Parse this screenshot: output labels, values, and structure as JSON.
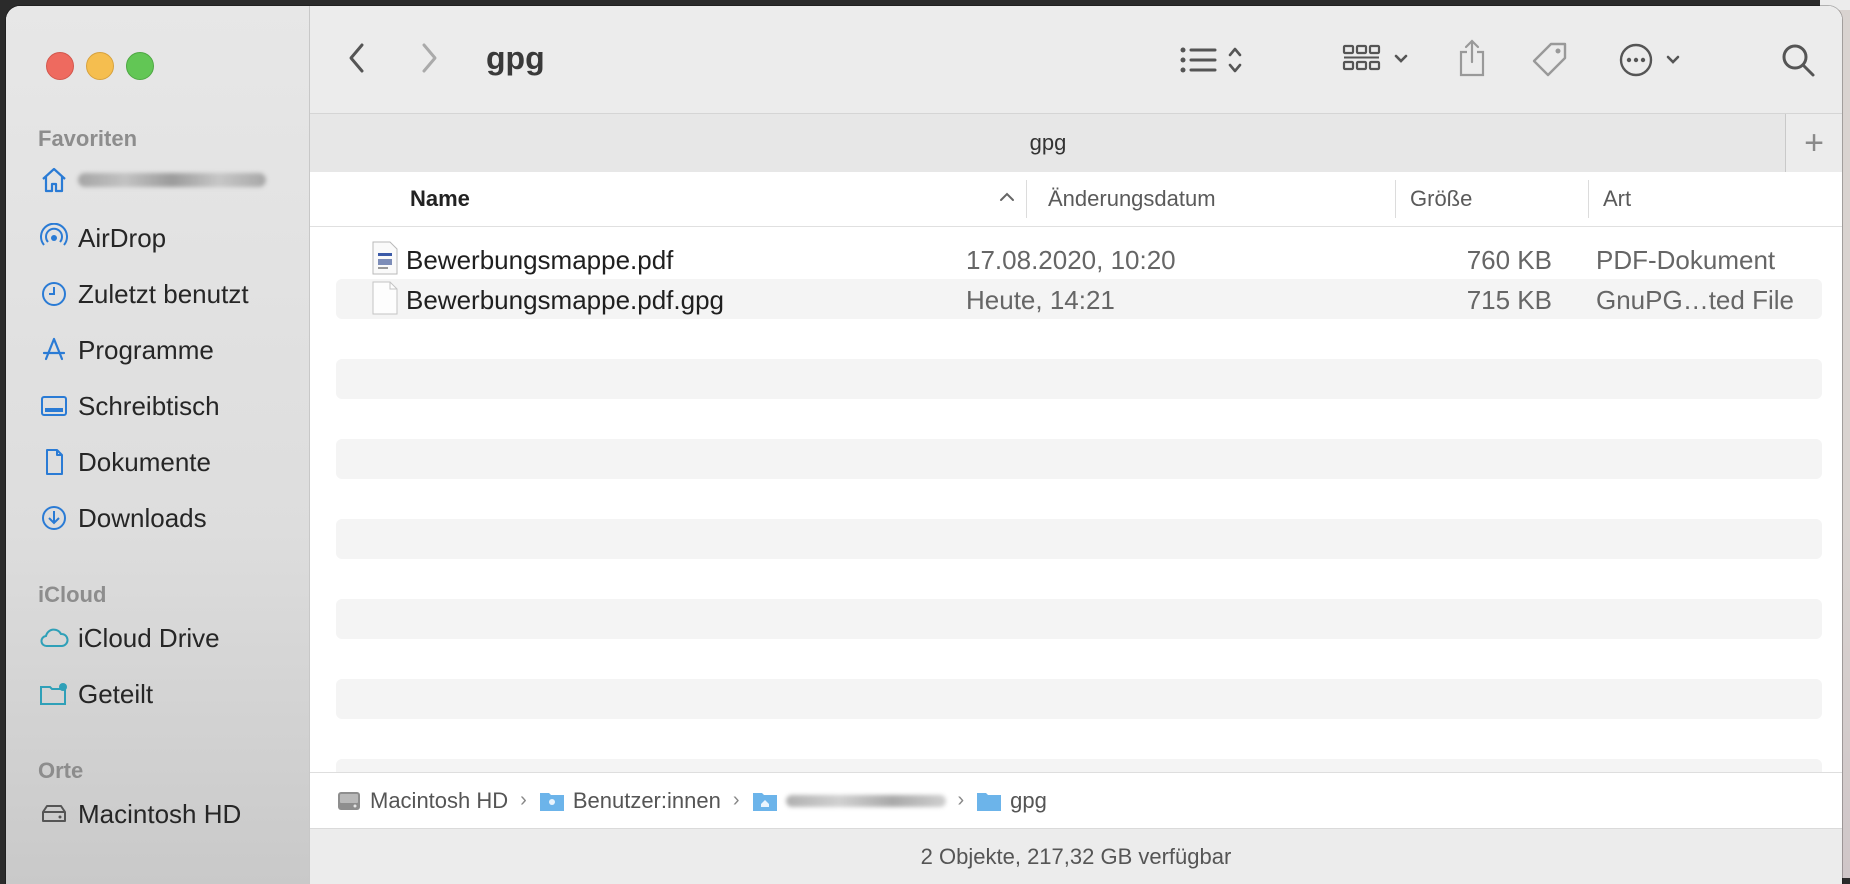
{
  "window": {
    "title": "gpg",
    "tab_title": "gpg",
    "tab_add": "+"
  },
  "sidebar": {
    "sections": [
      {
        "heading": "Favoriten"
      },
      {
        "heading": "iCloud"
      },
      {
        "heading": "Orte"
      }
    ],
    "items": [
      {
        "label": "",
        "icon": "home-icon",
        "redacted": true
      },
      {
        "label": "AirDrop",
        "icon": "airdrop-icon"
      },
      {
        "label": "Zuletzt benutzt",
        "icon": "clock-icon"
      },
      {
        "label": "Programme",
        "icon": "apps-icon"
      },
      {
        "label": "Schreibtisch",
        "icon": "desktop-icon"
      },
      {
        "label": "Dokumente",
        "icon": "document-icon"
      },
      {
        "label": "Downloads",
        "icon": "download-icon"
      },
      {
        "label": "iCloud Drive",
        "icon": "cloud-icon"
      },
      {
        "label": "Geteilt",
        "icon": "shared-folder-icon"
      },
      {
        "label": "Macintosh HD",
        "icon": "disk-icon"
      }
    ],
    "accent": "#2a7bd5"
  },
  "columns": {
    "name": "Name",
    "date": "Änderungsdatum",
    "size": "Größe",
    "kind": "Art"
  },
  "files": [
    {
      "name": "Bewerbungsmappe.pdf",
      "date": "17.08.2020, 10:20",
      "size": "760 KB",
      "kind": "PDF-Dokument",
      "icon": "pdf-file-icon"
    },
    {
      "name": "Bewerbungsmappe.pdf.gpg",
      "date": "Heute, 14:21",
      "size": "715 KB",
      "kind": "GnuPG…ted File",
      "icon": "blank-file-icon"
    }
  ],
  "path": {
    "items": [
      {
        "label": "Macintosh HD",
        "icon": "disk-icon"
      },
      {
        "label": "Benutzer:innen",
        "icon": "users-folder-icon"
      },
      {
        "label": "",
        "icon": "home-folder-icon",
        "redacted": true
      },
      {
        "label": "gpg",
        "icon": "folder-icon"
      }
    ]
  },
  "status": {
    "text": "2 Objekte, 217,32 GB verfügbar"
  }
}
